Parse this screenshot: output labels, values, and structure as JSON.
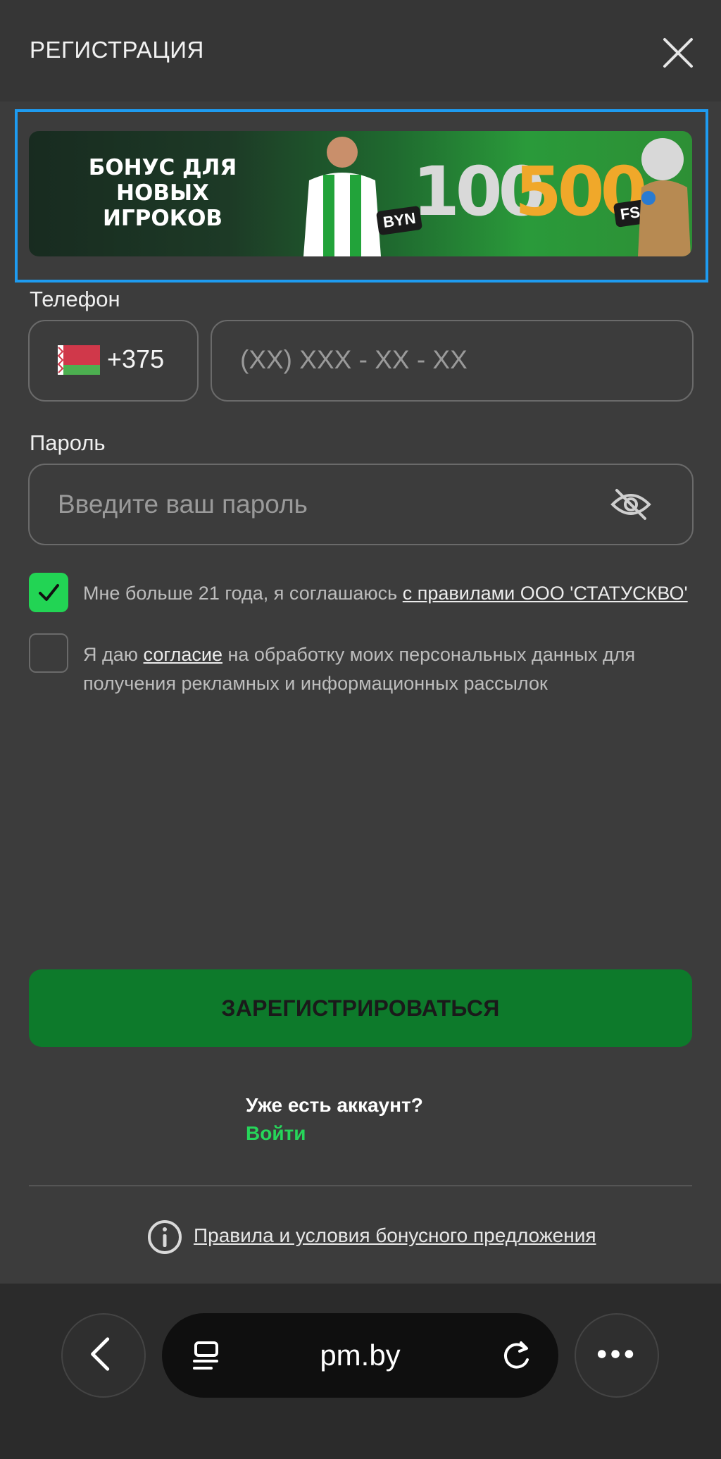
{
  "header": {
    "title": "РЕГИСТРАЦИЯ"
  },
  "banner": {
    "text": "БОНУС ДЛЯ НОВЫХ ИГРОКОВ",
    "amount_byn": "100",
    "currency": "BYN",
    "amount_fs": "500",
    "fs_label": "FS"
  },
  "phone": {
    "label": "Телефон",
    "country_code": "+375",
    "placeholder": "(XX) XXX - XX - XX"
  },
  "password": {
    "label": "Пароль",
    "placeholder": "Введите ваш пароль"
  },
  "consents": {
    "age": {
      "checked": true,
      "text": "Мне больше 21 года, я соглашаюсь ",
      "link": "с правилами ООО 'СТАТУСКВО'"
    },
    "marketing": {
      "checked": false,
      "text_before": "Я даю ",
      "link": "согласие",
      "text_after": " на обработку моих персональных данных для получения рекламных и информационных рассылок"
    }
  },
  "register_button": "ЗАРЕГИСТРИРОВАТЬСЯ",
  "account": {
    "question": "Уже есть аккаунт?",
    "login": "Войти"
  },
  "rules_link": "Правила и условия бонусного предложения",
  "browser": {
    "url": "pm.by"
  },
  "colors": {
    "accent_green": "#22d454",
    "button_green": "#0d7a2b",
    "highlight_blue": "#1e9bf0"
  }
}
